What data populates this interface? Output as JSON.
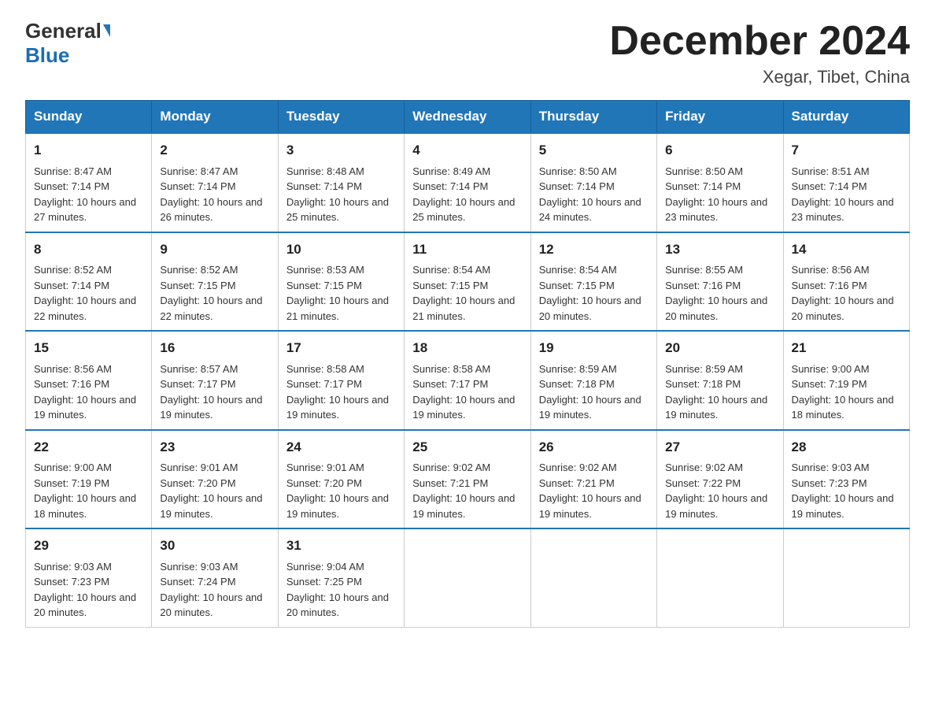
{
  "header": {
    "logo_general": "General",
    "logo_blue": "Blue",
    "title": "December 2024",
    "subtitle": "Xegar, Tibet, China"
  },
  "weekdays": [
    "Sunday",
    "Monday",
    "Tuesday",
    "Wednesday",
    "Thursday",
    "Friday",
    "Saturday"
  ],
  "weeks": [
    [
      {
        "day": "1",
        "sunrise": "8:47 AM",
        "sunset": "7:14 PM",
        "daylight": "10 hours and 27 minutes."
      },
      {
        "day": "2",
        "sunrise": "8:47 AM",
        "sunset": "7:14 PM",
        "daylight": "10 hours and 26 minutes."
      },
      {
        "day": "3",
        "sunrise": "8:48 AM",
        "sunset": "7:14 PM",
        "daylight": "10 hours and 25 minutes."
      },
      {
        "day": "4",
        "sunrise": "8:49 AM",
        "sunset": "7:14 PM",
        "daylight": "10 hours and 25 minutes."
      },
      {
        "day": "5",
        "sunrise": "8:50 AM",
        "sunset": "7:14 PM",
        "daylight": "10 hours and 24 minutes."
      },
      {
        "day": "6",
        "sunrise": "8:50 AM",
        "sunset": "7:14 PM",
        "daylight": "10 hours and 23 minutes."
      },
      {
        "day": "7",
        "sunrise": "8:51 AM",
        "sunset": "7:14 PM",
        "daylight": "10 hours and 23 minutes."
      }
    ],
    [
      {
        "day": "8",
        "sunrise": "8:52 AM",
        "sunset": "7:14 PM",
        "daylight": "10 hours and 22 minutes."
      },
      {
        "day": "9",
        "sunrise": "8:52 AM",
        "sunset": "7:15 PM",
        "daylight": "10 hours and 22 minutes."
      },
      {
        "day": "10",
        "sunrise": "8:53 AM",
        "sunset": "7:15 PM",
        "daylight": "10 hours and 21 minutes."
      },
      {
        "day": "11",
        "sunrise": "8:54 AM",
        "sunset": "7:15 PM",
        "daylight": "10 hours and 21 minutes."
      },
      {
        "day": "12",
        "sunrise": "8:54 AM",
        "sunset": "7:15 PM",
        "daylight": "10 hours and 20 minutes."
      },
      {
        "day": "13",
        "sunrise": "8:55 AM",
        "sunset": "7:16 PM",
        "daylight": "10 hours and 20 minutes."
      },
      {
        "day": "14",
        "sunrise": "8:56 AM",
        "sunset": "7:16 PM",
        "daylight": "10 hours and 20 minutes."
      }
    ],
    [
      {
        "day": "15",
        "sunrise": "8:56 AM",
        "sunset": "7:16 PM",
        "daylight": "10 hours and 19 minutes."
      },
      {
        "day": "16",
        "sunrise": "8:57 AM",
        "sunset": "7:17 PM",
        "daylight": "10 hours and 19 minutes."
      },
      {
        "day": "17",
        "sunrise": "8:58 AM",
        "sunset": "7:17 PM",
        "daylight": "10 hours and 19 minutes."
      },
      {
        "day": "18",
        "sunrise": "8:58 AM",
        "sunset": "7:17 PM",
        "daylight": "10 hours and 19 minutes."
      },
      {
        "day": "19",
        "sunrise": "8:59 AM",
        "sunset": "7:18 PM",
        "daylight": "10 hours and 19 minutes."
      },
      {
        "day": "20",
        "sunrise": "8:59 AM",
        "sunset": "7:18 PM",
        "daylight": "10 hours and 19 minutes."
      },
      {
        "day": "21",
        "sunrise": "9:00 AM",
        "sunset": "7:19 PM",
        "daylight": "10 hours and 18 minutes."
      }
    ],
    [
      {
        "day": "22",
        "sunrise": "9:00 AM",
        "sunset": "7:19 PM",
        "daylight": "10 hours and 18 minutes."
      },
      {
        "day": "23",
        "sunrise": "9:01 AM",
        "sunset": "7:20 PM",
        "daylight": "10 hours and 19 minutes."
      },
      {
        "day": "24",
        "sunrise": "9:01 AM",
        "sunset": "7:20 PM",
        "daylight": "10 hours and 19 minutes."
      },
      {
        "day": "25",
        "sunrise": "9:02 AM",
        "sunset": "7:21 PM",
        "daylight": "10 hours and 19 minutes."
      },
      {
        "day": "26",
        "sunrise": "9:02 AM",
        "sunset": "7:21 PM",
        "daylight": "10 hours and 19 minutes."
      },
      {
        "day": "27",
        "sunrise": "9:02 AM",
        "sunset": "7:22 PM",
        "daylight": "10 hours and 19 minutes."
      },
      {
        "day": "28",
        "sunrise": "9:03 AM",
        "sunset": "7:23 PM",
        "daylight": "10 hours and 19 minutes."
      }
    ],
    [
      {
        "day": "29",
        "sunrise": "9:03 AM",
        "sunset": "7:23 PM",
        "daylight": "10 hours and 20 minutes."
      },
      {
        "day": "30",
        "sunrise": "9:03 AM",
        "sunset": "7:24 PM",
        "daylight": "10 hours and 20 minutes."
      },
      {
        "day": "31",
        "sunrise": "9:04 AM",
        "sunset": "7:25 PM",
        "daylight": "10 hours and 20 minutes."
      },
      null,
      null,
      null,
      null
    ]
  ],
  "labels": {
    "sunrise": "Sunrise:",
    "sunset": "Sunset:",
    "daylight": "Daylight:"
  }
}
